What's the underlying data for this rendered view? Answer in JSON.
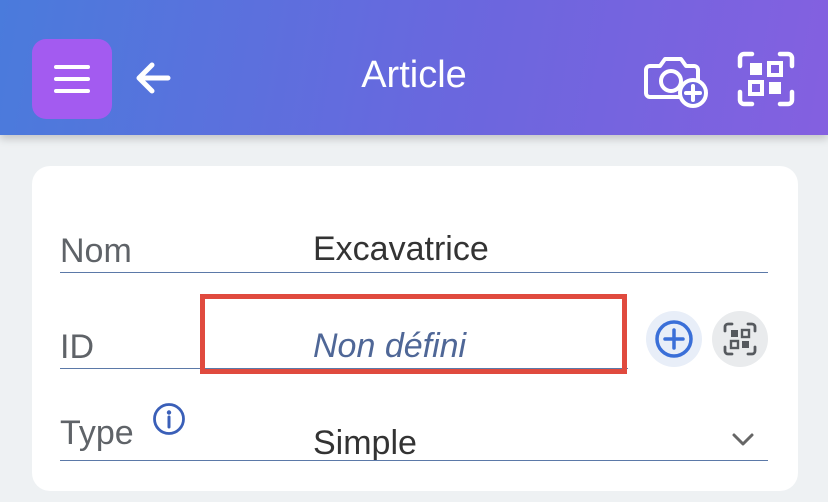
{
  "header": {
    "title": "Article",
    "menu_icon": "hamburger-menu-icon",
    "back_icon": "arrow-left-icon",
    "camera_icon": "camera-add-icon",
    "scan_icon": "qr-scan-icon",
    "gradient_colors": [
      "#4a7bdc",
      "#6a67de",
      "#8460e0"
    ],
    "menu_button_color": "#a35bf0"
  },
  "form": {
    "name": {
      "label": "Nom",
      "value": "Excavatrice"
    },
    "id": {
      "label": "ID",
      "placeholder": "Non défini",
      "add_icon": "plus-circle-icon",
      "scan_icon": "qr-scan-icon"
    },
    "type": {
      "label": "Type",
      "value": "Simple",
      "info_icon": "info-icon",
      "dropdown_icon": "chevron-down-icon"
    }
  },
  "highlight_color": "#e04a3e"
}
